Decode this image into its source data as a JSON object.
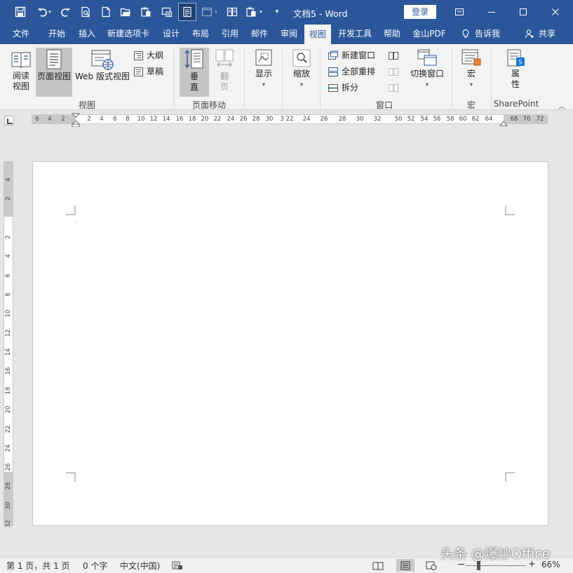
{
  "app": {
    "doc_name": "文档5",
    "app_name": "Word",
    "title_sep": " - ",
    "login_label": "登录",
    "accent": "#2b579a"
  },
  "tabs": [
    {
      "label": "文件"
    },
    {
      "label": "开始"
    },
    {
      "label": "插入"
    },
    {
      "label": "新建选项卡"
    },
    {
      "label": "设计"
    },
    {
      "label": "布局"
    },
    {
      "label": "引用"
    },
    {
      "label": "邮件"
    },
    {
      "label": "审阅"
    },
    {
      "label": "视图",
      "active": true
    },
    {
      "label": "开发工具"
    },
    {
      "label": "帮助"
    },
    {
      "label": "金山PDF"
    }
  ],
  "tell_me": "告诉我",
  "share": "共享",
  "ribbon": {
    "views": {
      "read_mode": "阅读视图",
      "read_mode_l1": "阅读",
      "read_mode_l2": "视图",
      "print_layout": "页面视图",
      "web_layout": "Web 版式视图",
      "outline": "大纲",
      "draft": "草稿",
      "group_label": "视图"
    },
    "page_movement": {
      "vertical_l1": "垂",
      "vertical_l2": "直",
      "side_l1": "翻",
      "side_l2": "页",
      "group_label": "页面移动"
    },
    "show": {
      "label": "显示"
    },
    "zoom": {
      "label": "缩放"
    },
    "window": {
      "new_window": "新建窗口",
      "arrange_all": "全部重排",
      "split": "拆分",
      "switch_windows": "切换窗口",
      "group_label": "窗口"
    },
    "macros": {
      "label": "宏",
      "group_label": "宏"
    },
    "sharepoint": {
      "label_l1": "属",
      "label_l2": "性",
      "group_label": "SharePoint"
    }
  },
  "hruler": [
    "6",
    "4",
    "2",
    "2",
    "4",
    "6",
    "8",
    "10",
    "12",
    "14",
    "16",
    "18",
    "20",
    "22",
    "24",
    "26",
    "28",
    "30",
    "3 22",
    "24",
    "26",
    "28",
    "30",
    "32",
    "50",
    "52",
    "54",
    "56",
    "58",
    "60",
    "62",
    "64",
    "68",
    "70",
    "72"
  ],
  "vruler": [
    "4",
    "2",
    "2",
    "4",
    "6",
    "8",
    "10",
    "12",
    "14",
    "16",
    "18",
    "20",
    "22",
    "24",
    "26",
    "28",
    "30",
    "32"
  ],
  "status": {
    "page": "第 1 页，共 1 页",
    "words": "0 个字",
    "language": "中文(中国)",
    "zoom_minus": "−",
    "zoom_plus": "+",
    "zoom": "66%"
  },
  "watermark": "头条 @爆炒Office"
}
